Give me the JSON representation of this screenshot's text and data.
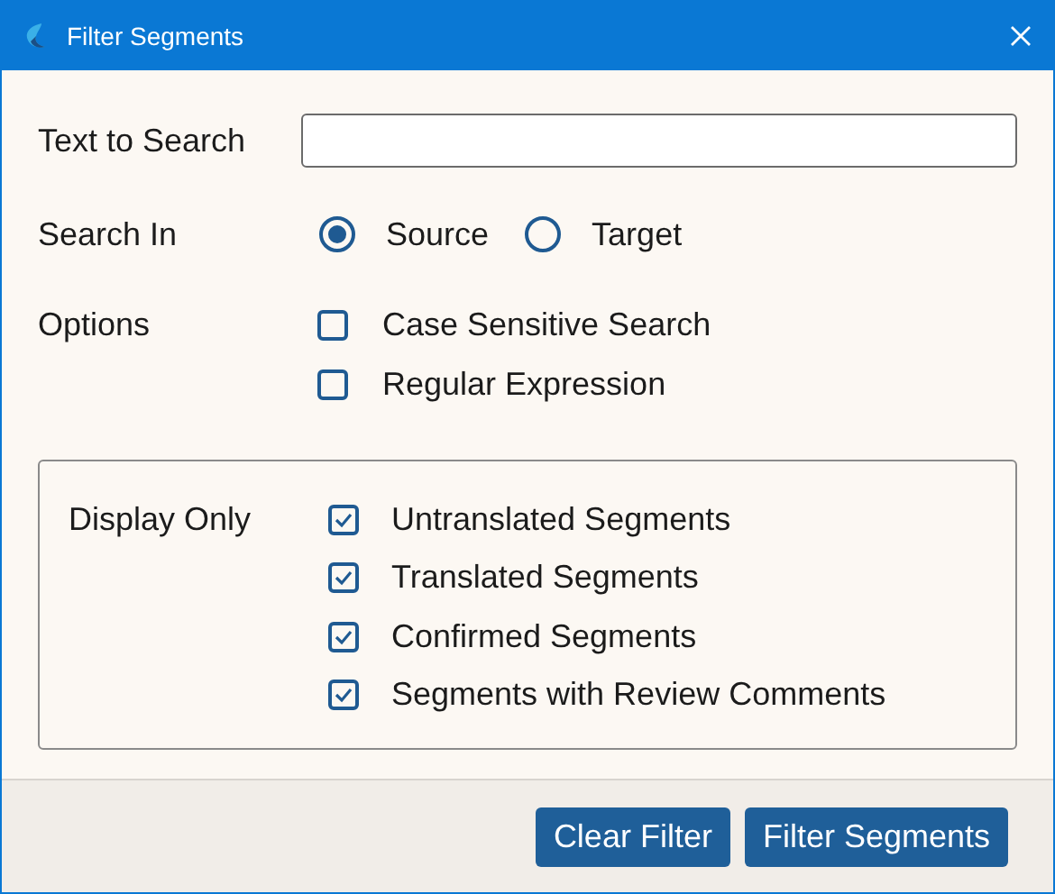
{
  "window": {
    "title": "Filter Segments"
  },
  "text_to_search": {
    "label": "Text to Search"
  },
  "search_in": {
    "label": "Search In",
    "options": [
      {
        "label": "Source",
        "selected": true
      },
      {
        "label": "Target",
        "selected": false
      }
    ]
  },
  "options": {
    "label": "Options",
    "items": [
      {
        "label": "Case Sensitive Search",
        "checked": false
      },
      {
        "label": "Regular Expression",
        "checked": false
      }
    ]
  },
  "display_only": {
    "label": "Display Only",
    "items": [
      {
        "label": "Untranslated Segments",
        "checked": true
      },
      {
        "label": "Translated Segments",
        "checked": true
      },
      {
        "label": "Confirmed Segments",
        "checked": true
      },
      {
        "label": "Segments with Review Comments",
        "checked": true
      }
    ]
  },
  "buttons": [
    "Clear Filter",
    "Filter Segments"
  ]
}
